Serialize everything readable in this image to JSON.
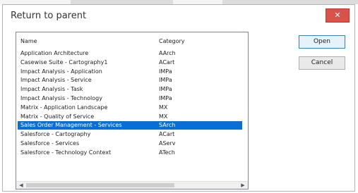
{
  "window": {
    "title": "Return to parent",
    "close_glyph": "✕"
  },
  "list": {
    "headers": {
      "name": "Name",
      "category": "Category"
    },
    "rows": [
      {
        "name": "Application Architecture",
        "category": "AArch"
      },
      {
        "name": "Casewise Suite - Cartography1",
        "category": "ACart"
      },
      {
        "name": "Impact Analysis - Application",
        "category": "IMPa"
      },
      {
        "name": "Impact Analysis - Service",
        "category": "IMPa"
      },
      {
        "name": "Impact Analysis - Task",
        "category": "IMPa"
      },
      {
        "name": "Impact Analysis - Technology",
        "category": "IMPa"
      },
      {
        "name": "Matrix - Application Landscape",
        "category": "MX"
      },
      {
        "name": "Matrix - Quality of Service",
        "category": "MX"
      },
      {
        "name": "Sales Order Management - Services",
        "category": "SArch",
        "selected": true
      },
      {
        "name": "Salesforce - Cartography",
        "category": "ACart"
      },
      {
        "name": "Salesforce - Services",
        "category": "AServ"
      },
      {
        "name": "Salesforce - Technology Context",
        "category": "ATech"
      }
    ],
    "scroll_left_glyph": "◀",
    "scroll_right_glyph": "▶"
  },
  "buttons": {
    "open": "Open",
    "cancel": "Cancel"
  },
  "colors": {
    "selection": "#0a6fd4",
    "close": "#d9534a"
  }
}
